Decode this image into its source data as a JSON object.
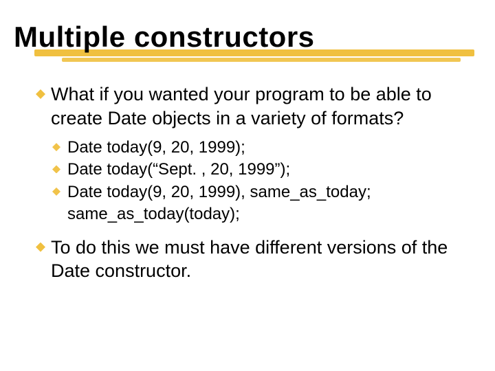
{
  "slide": {
    "title": "Multiple constructors",
    "bullets": [
      {
        "text": "What if you wanted your program to  be able to create Date objects in a variety of formats?",
        "sub": [
          "Date today(9, 20, 1999);",
          "Date today(“Sept. , 20, 1999”);",
          "Date today(9, 20, 1999), same_as_today; same_as_today(today);"
        ]
      },
      {
        "text": "To do this we must have different versions of the Date constructor.",
        "sub": []
      }
    ]
  }
}
